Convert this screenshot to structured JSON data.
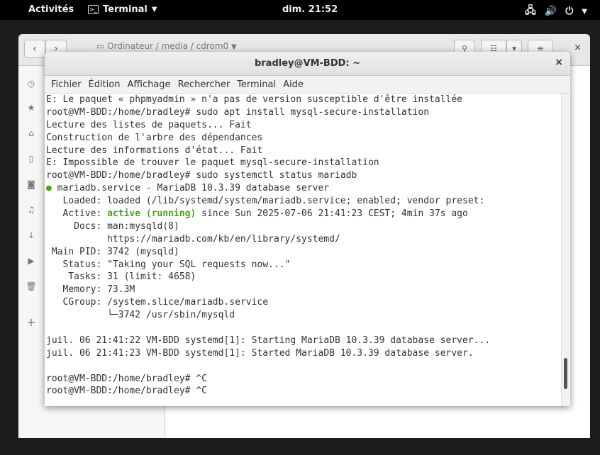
{
  "topbar": {
    "activities": "Activités",
    "app_menu": "Terminal",
    "clock": "dim. 21:52",
    "tray_icons": [
      "network-icon",
      "volume-icon",
      "power-icon"
    ]
  },
  "file_manager": {
    "path_segments": [
      "Ordinateur",
      "media",
      "cdrom0"
    ]
  },
  "terminal": {
    "title": "bradley@VM-BDD: ~",
    "close_glyph": "×",
    "menu": [
      "Fichier",
      "Édition",
      "Affichage",
      "Rechercher",
      "Terminal",
      "Aide"
    ],
    "lines": [
      "E: Le paquet « phpmyadmin » n'a pas de version susceptible d'être installée",
      "root@VM-BDD:/home/bradley# sudo apt install mysql-secure-installation",
      "Lecture des listes de paquets... Fait",
      "Construction de l'arbre des dépendances",
      "Lecture des informations d'état... Fait",
      "E: Impossible de trouver le paquet mysql-secure-installation",
      "root@VM-BDD:/home/bradley# sudo systemctl status mariadb",
      " mariadb.service - MariaDB 10.3.39 database server",
      "   Loaded: loaded (/lib/systemd/system/mariadb.service; enabled; vendor preset:",
      "   Active: ",
      "     Docs: man:mysqld(8)",
      "           https://mariadb.com/kb/en/library/systemd/",
      " Main PID: 3742 (mysqld)",
      "   Status: \"Taking your SQL requests now...\"",
      "    Tasks: 31 (limit: 4658)",
      "   Memory: 73.3M",
      "   CGroup: /system.slice/mariadb.service",
      "           └─3742 /usr/sbin/mysqld",
      "",
      "juil. 06 21:41:22 VM-BDD systemd[1]: Starting MariaDB 10.3.39 database server...",
      "juil. 06 21:41:23 VM-BDD systemd[1]: Started MariaDB 10.3.39 database server.",
      "",
      "root@VM-BDD:/home/bradley# ^C",
      "root@VM-BDD:/home/bradley# ^C"
    ],
    "status_dot": "●",
    "active_state": "active (running)",
    "active_rest": " since Sun 2025-07-06 21:41:23 CEST; 4min 37s ago",
    "active_color": "#4aa61b"
  }
}
